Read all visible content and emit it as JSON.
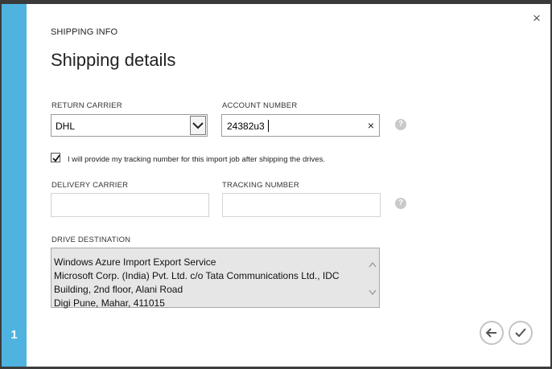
{
  "dialog": {
    "step_number": "1",
    "eyebrow": "SHIPPING INFO",
    "title": "Shipping details",
    "close_symbol": "×"
  },
  "return_carrier": {
    "label": "RETURN CARRIER",
    "selected": "DHL"
  },
  "account_number": {
    "label": "ACCOUNT NUMBER",
    "value": "24382u3",
    "clear_symbol": "×"
  },
  "tracking_checkbox": {
    "checked": true,
    "label": "I will provide my tracking number for this import job after shipping the drives."
  },
  "delivery_carrier": {
    "label": "DELIVERY CARRIER",
    "value": ""
  },
  "tracking_number": {
    "label": "TRACKING NUMBER",
    "value": ""
  },
  "drive_destination": {
    "label": "DRIVE DESTINATION",
    "lines": [
      "Windows Azure Import Export Service",
      "Microsoft Corp. (India) Pvt. Ltd. c/o Tata Communications Ltd., IDC",
      "Building, 2nd floor, Alani Road",
      "Digi Pune, Mahar, 411015"
    ]
  },
  "help_symbol": "?",
  "colors": {
    "accent_strip": "#4fb3e0",
    "help_icon": "#c9c9c9"
  },
  "icons": {
    "back": "arrow-left-icon",
    "finish": "checkmark-icon"
  }
}
